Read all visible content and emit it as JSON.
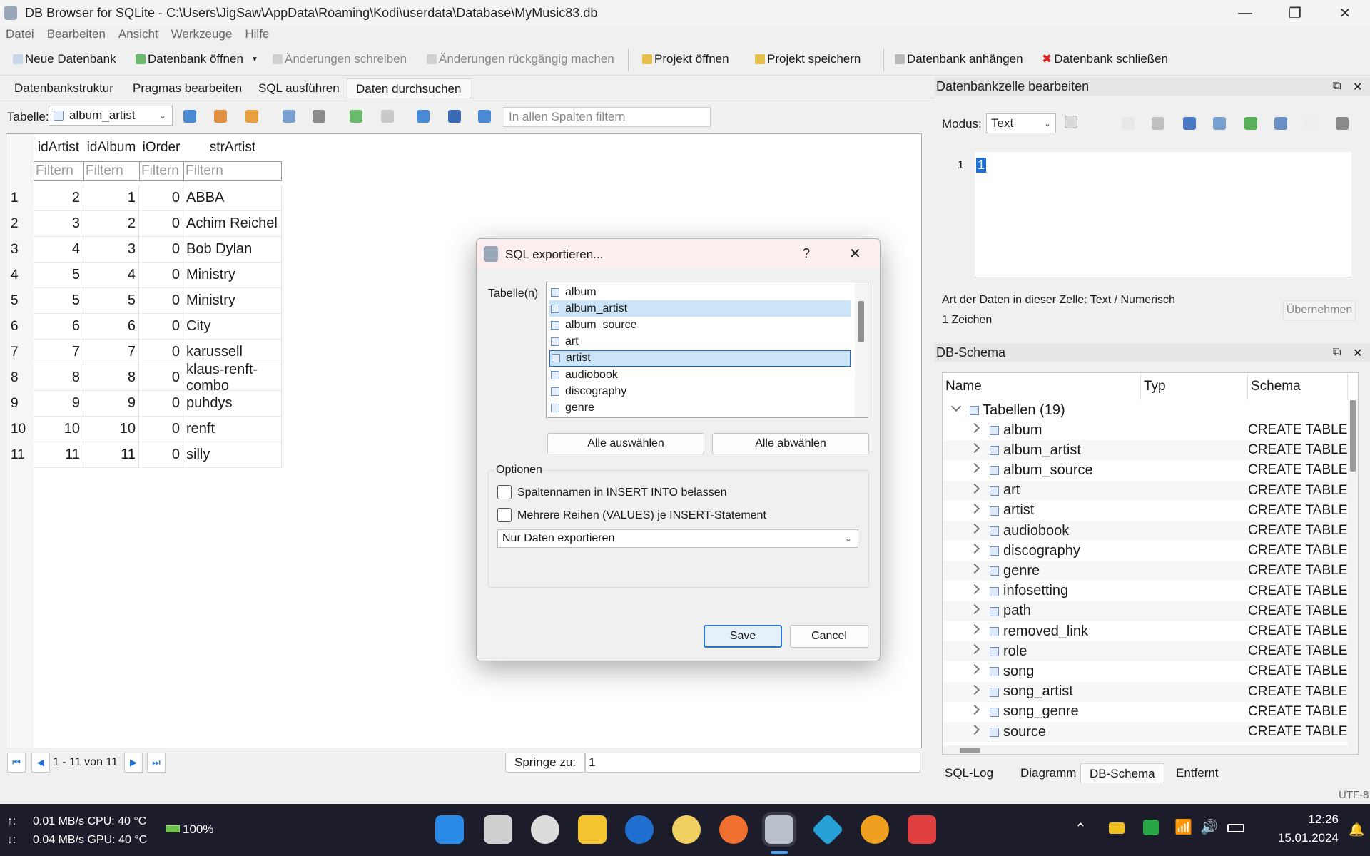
{
  "window": {
    "title": "DB Browser for SQLite - C:\\Users\\JigSaw\\AppData\\Roaming\\Kodi\\userdata\\Database\\MyMusic83.db"
  },
  "menu": [
    "Datei",
    "Bearbeiten",
    "Ansicht",
    "Werkzeuge",
    "Hilfe"
  ],
  "toolbar": {
    "new_db": "Neue Datenbank",
    "open_db": "Datenbank öffnen",
    "write_changes": "Änderungen schreiben",
    "revert_changes": "Änderungen rückgängig machen",
    "open_project": "Projekt öffnen",
    "save_project": "Projekt speichern",
    "attach_db": "Datenbank anhängen",
    "close_db": "Datenbank schließen"
  },
  "tabs": [
    "Datenbankstruktur",
    "Pragmas bearbeiten",
    "SQL ausführen",
    "Daten durchsuchen"
  ],
  "browse": {
    "table_label": "Tabelle:",
    "table_value": "album_artist",
    "filter_all_placeholder": "In allen Spalten filtern",
    "columns": [
      "idArtist",
      "idAlbum",
      "iOrder",
      "strArtist"
    ],
    "filter_placeholder": "Filtern",
    "rows": [
      {
        "n": "1",
        "idArtist": "2",
        "idAlbum": "1",
        "iOrder": "0",
        "strArtist": "ABBA"
      },
      {
        "n": "2",
        "idArtist": "3",
        "idAlbum": "2",
        "iOrder": "0",
        "strArtist": "Achim Reichel"
      },
      {
        "n": "3",
        "idArtist": "4",
        "idAlbum": "3",
        "iOrder": "0",
        "strArtist": "Bob Dylan"
      },
      {
        "n": "4",
        "idArtist": "5",
        "idAlbum": "4",
        "iOrder": "0",
        "strArtist": "Ministry"
      },
      {
        "n": "5",
        "idArtist": "5",
        "idAlbum": "5",
        "iOrder": "0",
        "strArtist": "Ministry"
      },
      {
        "n": "6",
        "idArtist": "6",
        "idAlbum": "6",
        "iOrder": "0",
        "strArtist": "City"
      },
      {
        "n": "7",
        "idArtist": "7",
        "idAlbum": "7",
        "iOrder": "0",
        "strArtist": "karussell"
      },
      {
        "n": "8",
        "idArtist": "8",
        "idAlbum": "8",
        "iOrder": "0",
        "strArtist": "klaus-renft-combo"
      },
      {
        "n": "9",
        "idArtist": "9",
        "idAlbum": "9",
        "iOrder": "0",
        "strArtist": "puhdys"
      },
      {
        "n": "10",
        "idArtist": "10",
        "idAlbum": "10",
        "iOrder": "0",
        "strArtist": "renft"
      },
      {
        "n": "11",
        "idArtist": "11",
        "idAlbum": "11",
        "iOrder": "0",
        "strArtist": "silly"
      }
    ],
    "record_range": "1 - 11 von 11",
    "goto_label": "Springe zu:",
    "goto_value": "1"
  },
  "edit_cell": {
    "title": "Datenbankzelle bearbeiten",
    "mode_label": "Modus:",
    "mode_value": "Text",
    "line_no": "1",
    "cell_value": "1",
    "type_info": "Art der Daten in dieser Zelle: Text / Numerisch",
    "char_count": "1 Zeichen",
    "apply": "Übernehmen"
  },
  "schema": {
    "title": "DB-Schema",
    "columns": [
      "Name",
      "Typ",
      "Schema"
    ],
    "root": "Tabellen (19)",
    "tables": [
      "album",
      "album_artist",
      "album_source",
      "art",
      "artist",
      "audiobook",
      "discography",
      "genre",
      "infosetting",
      "path",
      "removed_link",
      "role",
      "song",
      "song_artist",
      "song_genre",
      "source"
    ],
    "schema_text": "CREATE TABLE"
  },
  "bottom_tabs": [
    "SQL-Log",
    "Diagramm",
    "DB-Schema",
    "Entfernt"
  ],
  "status": {
    "encoding": "UTF-8"
  },
  "dialog": {
    "title": "SQL exportieren...",
    "help": "?",
    "tables_label": "Tabelle(n)",
    "tables": [
      "album",
      "album_artist",
      "album_source",
      "art",
      "artist",
      "audiobook",
      "discography",
      "genre"
    ],
    "select_all": "Alle auswählen",
    "deselect_all": "Alle abwählen",
    "options_label": "Optionen",
    "opt1": "Spaltennamen in INSERT INTO belassen",
    "opt2": "Mehrere Reihen (VALUES) je INSERT-Statement",
    "export_mode": "Nur Daten exportieren",
    "save": "Save",
    "cancel": "Cancel"
  },
  "taskbar": {
    "net_up": "0.01 MB/s CPU:  40 °C",
    "net_down": "0.04 MB/s GPU:  40 °C",
    "up_arrow": "↑:",
    "down_arrow": "↓:",
    "battery": "100%",
    "time": "12:26",
    "date": "15.01.2024"
  },
  "colors": {
    "accent": "#1e6fd0",
    "selection": "#cce4f7",
    "taskbar": "#1c1c2a"
  }
}
